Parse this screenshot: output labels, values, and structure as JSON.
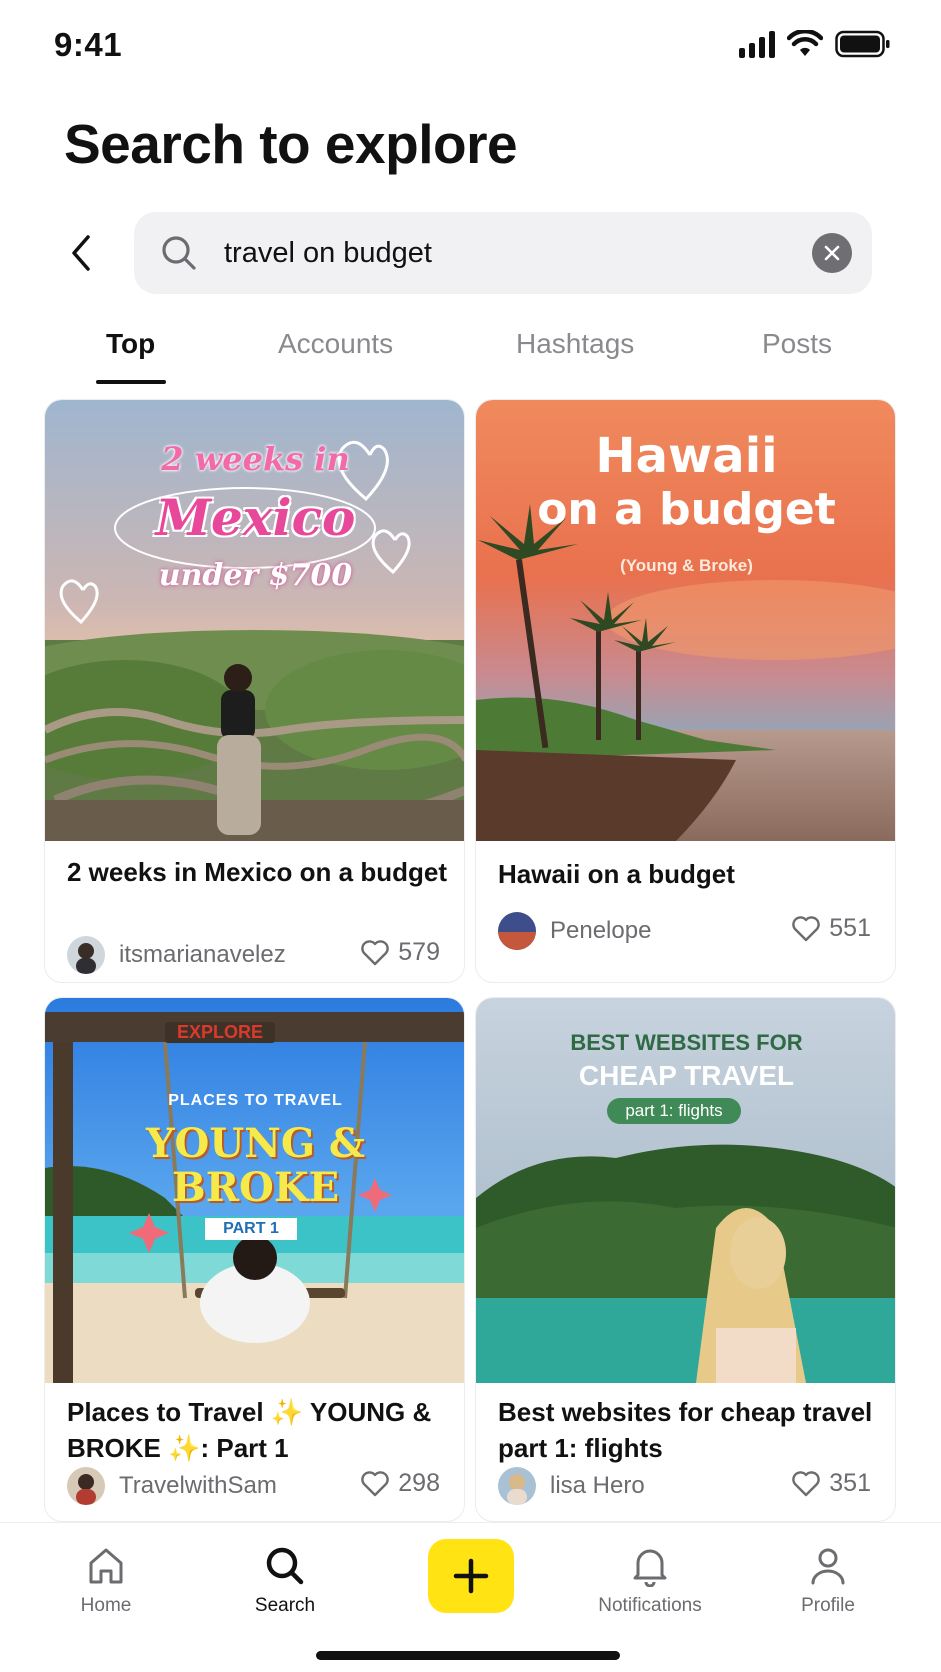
{
  "status_bar": {
    "time": "9:41"
  },
  "header": {
    "title": "Search to explore"
  },
  "search": {
    "query": "travel on budget"
  },
  "tabs": [
    {
      "label": "Top"
    },
    {
      "label": "Accounts"
    },
    {
      "label": "Hashtags"
    },
    {
      "label": "Posts"
    }
  ],
  "posts": [
    {
      "title": "2 weeks in Mexico on a budget",
      "author": "itsmarianavelez",
      "likes": "579",
      "overlay": {
        "line1": "2 weeks in",
        "line2": "Mexico",
        "line3": "under $700"
      }
    },
    {
      "title": "Hawaii on a budget",
      "author": "Penelope",
      "likes": "551",
      "overlay": {
        "line1": "Hawaii",
        "line2": "on a budget",
        "line3": "(Young & Broke)"
      }
    },
    {
      "title": "Places to Travel ✨ YOUNG & BROKE ✨: Part 1",
      "author": "TravelwithSam",
      "likes": "298",
      "overlay": {
        "sign": "EXPLORE",
        "line1": "PLACES TO TRAVEL",
        "line2": "YOUNG &",
        "line3": "BROKE",
        "badge": "PART 1"
      }
    },
    {
      "title": "Best websites for cheap travel part 1: flights",
      "author": "lisa Hero",
      "likes": "351",
      "overlay": {
        "line1": "BEST WEBSITES FOR",
        "line2": "CHEAP TRAVEL",
        "badge": "part 1: flights"
      }
    }
  ],
  "nav": [
    {
      "label": "Home",
      "icon": "home-icon"
    },
    {
      "label": "Search",
      "icon": "search-icon"
    },
    {
      "label": "",
      "icon": "plus-icon"
    },
    {
      "label": "Notifications",
      "icon": "bell-icon"
    },
    {
      "label": "Profile",
      "icon": "person-icon"
    }
  ],
  "colors": {
    "accent": "#ffe312",
    "text": "#111111",
    "muted": "#6b6b70"
  }
}
